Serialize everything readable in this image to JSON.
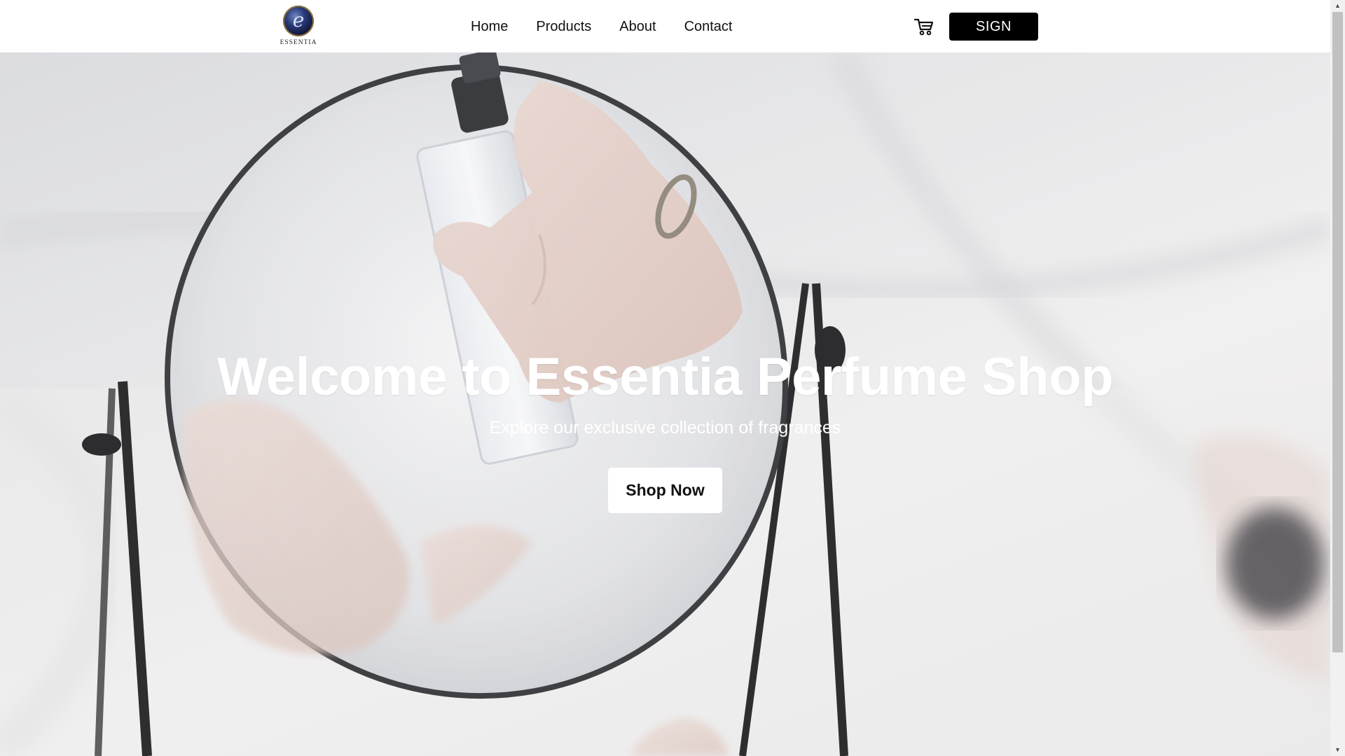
{
  "brand": {
    "logo_letter": "e",
    "logo_text": "ESSENTIA"
  },
  "nav": {
    "links": [
      "Home",
      "Products",
      "About",
      "Contact"
    ],
    "cart_icon": "cart-icon",
    "sign_label": "SIGN"
  },
  "hero": {
    "title": "Welcome to Essentia Perfume Shop",
    "subtitle": "Explore our exclusive collection of fragrances",
    "cta_label": "Shop Now"
  },
  "colors": {
    "nav_bg": "#ffffff",
    "button_dark": "#000000",
    "hero_text": "#ffffff"
  }
}
